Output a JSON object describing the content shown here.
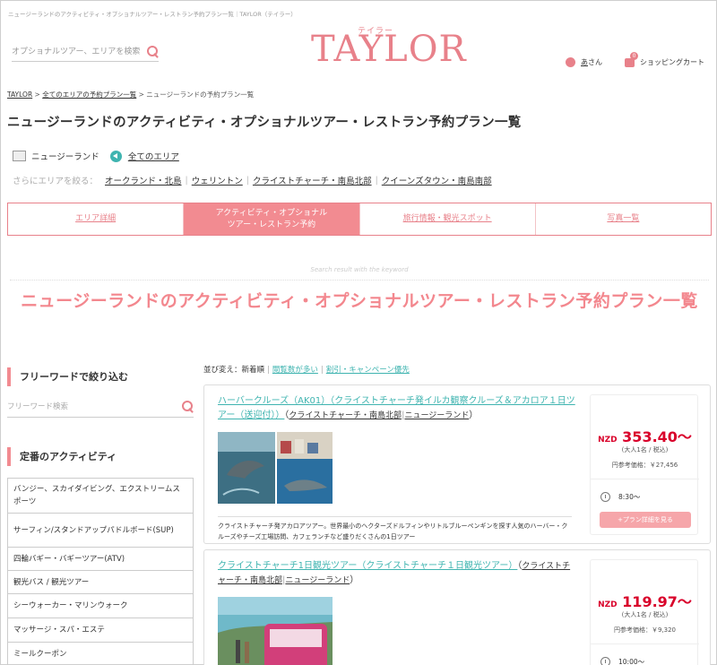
{
  "header": {
    "topline": "ニュージーランドのアクティビティ・オプショナルツアー・レストラン予約プラン一覧｜TAYLOR（テイラー）",
    "search_placeholder": "オプショナルツアー、エリアを検索",
    "logo_sub": "テイラー",
    "logo_main": "TAYLOR",
    "user_name": "あ",
    "user_suffix": "さん",
    "cart_count": "0",
    "cart_label": "ショッピングカート"
  },
  "breadcrumb": {
    "home": "TAYLOR",
    "sep": " > ",
    "all_area": "全てのエリアの予約プラン一覧",
    "current": "ニュージーランドの予約プラン一覧"
  },
  "page_title": "ニュージーランドのアクティビティ・オプショナルツアー・レストラン予約プラン一覧",
  "region": {
    "name": "ニュージーランド",
    "all_areas": "全てのエリア",
    "narrow_label": "さらにエリアを絞る：",
    "areas": [
      "オークランド・北島",
      "ウェリントン",
      "クライストチャーチ・南島北部",
      "クイーンズタウン・南島南部"
    ],
    "separator": "|"
  },
  "tabs": [
    {
      "l1": "エリア詳細",
      "l2": ""
    },
    {
      "l1": "アクティビティ・オプショナル",
      "l2": "ツアー・レストラン予約"
    },
    {
      "l1": "旅行情報・観光スポット",
      "l2": ""
    },
    {
      "l1": "写真一覧",
      "l2": ""
    }
  ],
  "keyword_label": "Search result with the keyword",
  "big_title": "ニュージーランドのアクティビティ・オプショナルツアー・レストラン予約プラン一覧",
  "sidebar": {
    "freeword_heading": "フリーワードで絞り込む",
    "freeword_placeholder": "フリーワード検索",
    "activity_heading": "定番のアクティビティ",
    "categories": [
      "バンジー、スカイダイビング、エクストリームスポーツ",
      "サーフィン/スタンドアップパドルボード(SUP)",
      "四輪バギー・バギーツアー(ATV)",
      "観光バス / 観光ツアー",
      "シーウォーカー・マリンウォーク",
      "マッサージ・スパ・エステ",
      "ミールクーポン"
    ]
  },
  "sort": {
    "label": "並び変え：新着順",
    "options": [
      "閲覧数が多い",
      "割引・キャンペーン優先"
    ],
    "separator": "|"
  },
  "products": [
    {
      "title": "ハーバークルーズ（AK01）（クライストチャーチ発イルカ観察クルーズ＆アカロア１日ツアー（送迎付））",
      "area_open": "（",
      "area": "クライストチャーチ・南島北部",
      "country": "ニュージーランド",
      "area_close": "）",
      "description": "クライストチャーチ発アカロアツアー。世界最小のヘクターズドルフィンやリトルブルーペンギンを探す人気のハーバー・クルーズやチーズ工場訪問、カフェランチなど盛りだくさんの1日ツアー",
      "currency": "NZD",
      "price": "353.40〜",
      "per": "(大人1名 / 税込)",
      "jpy_ref": "円参考価格：￥27,456",
      "start_time": "8:30〜",
      "button": "+プラン詳細を見る"
    },
    {
      "title": "クライストチャーチ1日観光ツアー（クライストチャーチ１日観光ツアー）",
      "area_open": "（",
      "area": "クライストチャーチ・南島北部",
      "country": "ニュージーランド",
      "area_close": "）",
      "description": "",
      "currency": "NZD",
      "price": "119.97〜",
      "per": "(大人1名 / 税込)",
      "jpy_ref": "円参考価格：￥9,320",
      "start_time": "10:00〜",
      "button": ""
    }
  ],
  "colors": {
    "accent_pink": "#f28b91",
    "link_teal": "#3fb4b0",
    "price_red": "#d9002a"
  }
}
